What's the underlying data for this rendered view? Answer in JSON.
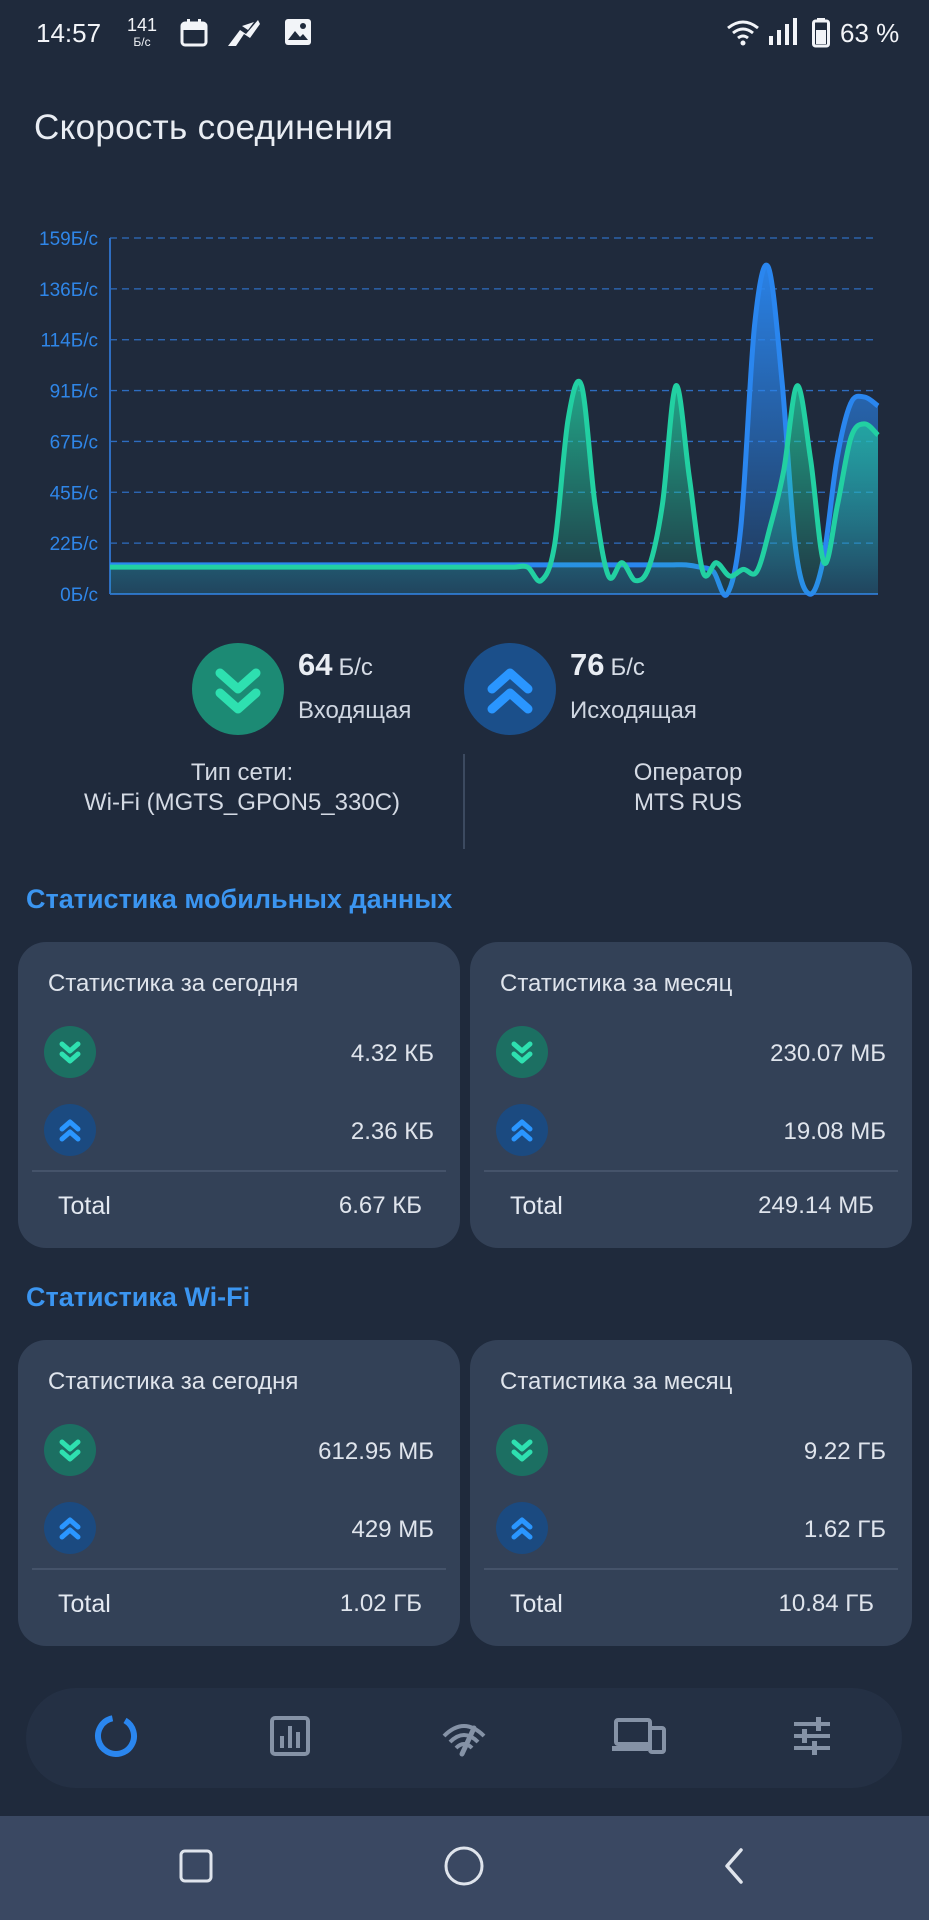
{
  "status_bar": {
    "time": "14:57",
    "net_speed_value": "141",
    "net_speed_unit": "Б/с",
    "battery_text": "63 %",
    "icons": [
      "calendar-icon",
      "app-icon",
      "image-icon",
      "wifi-icon",
      "signal-icon",
      "battery-icon"
    ]
  },
  "title": "Скорость соединения",
  "chart_data": {
    "type": "area",
    "y_tick_labels": [
      "159Б/с",
      "136Б/с",
      "114Б/с",
      "91Б/с",
      "67Б/с",
      "45Б/с",
      "22Б/с",
      "0Б/с"
    ],
    "ylim": [
      0,
      159
    ],
    "grid": true,
    "series": [
      {
        "color": "#2a86ef",
        "values": [
          13,
          13,
          13,
          13,
          13,
          13,
          13,
          13,
          13,
          13,
          13,
          13,
          13,
          13,
          13,
          13,
          13,
          13,
          13,
          13,
          13,
          13,
          13,
          13,
          13,
          13,
          13,
          13,
          13,
          13,
          13,
          13,
          13,
          13,
          13,
          13,
          13,
          13,
          13,
          13,
          13,
          13,
          13,
          12,
          10,
          0,
          30,
          120,
          146,
          95,
          20,
          0,
          15,
          60,
          85,
          88,
          84
        ]
      },
      {
        "color": "#22d0a2",
        "values": [
          12,
          12,
          12,
          12,
          12,
          12,
          12,
          12,
          12,
          12,
          12,
          12,
          12,
          12,
          12,
          12,
          12,
          12,
          12,
          12,
          12,
          12,
          12,
          12,
          12,
          12,
          12,
          12,
          12,
          12,
          12,
          12,
          6,
          22,
          78,
          93,
          40,
          8,
          14,
          6,
          12,
          40,
          93,
          52,
          10,
          14,
          8,
          11,
          10,
          30,
          55,
          93,
          60,
          14,
          40,
          70,
          76,
          71
        ]
      }
    ]
  },
  "incoming": {
    "value": "64",
    "unit": "Б/с",
    "label": "Входящая"
  },
  "outgoing": {
    "value": "76",
    "unit": "Б/с",
    "label": "Исходящая"
  },
  "network": {
    "type_label": "Тип сети:",
    "type_value": "Wi-Fi (MGTS_GPON5_330C)",
    "operator_label": "Оператор",
    "operator_value": "MTS RUS"
  },
  "mobile": {
    "section_title": "Статистика мобильных данных",
    "today": {
      "title": "Статистика за сегодня",
      "down": "4.32 КБ",
      "up": "2.36 КБ",
      "total_label": "Total",
      "total": "6.67 КБ"
    },
    "month": {
      "title": "Статистика за месяц",
      "down": "230.07 МБ",
      "up": "19.08 МБ",
      "total_label": "Total",
      "total": "249.14 МБ"
    }
  },
  "wifi": {
    "section_title": "Статистика Wi-Fi",
    "today": {
      "title": "Статистика за сегодня",
      "down": "612.95 МБ",
      "up": "429 МБ",
      "total_label": "Total",
      "total": "1.02 ГБ"
    },
    "month": {
      "title": "Статистика за месяц",
      "down": "9.22 ГБ",
      "up": "1.62 ГБ",
      "total_label": "Total",
      "total": "10.84 ГБ"
    }
  },
  "nav": [
    "speed-dashboard-icon",
    "statistics-icon",
    "speedtest-icon",
    "devices-icon",
    "settings-icon"
  ],
  "colors": {
    "incoming": "#22d0a2",
    "outgoing": "#2a86ef",
    "accent": "#3b95f0",
    "background": "#1f2a3c",
    "card": "#334157"
  }
}
